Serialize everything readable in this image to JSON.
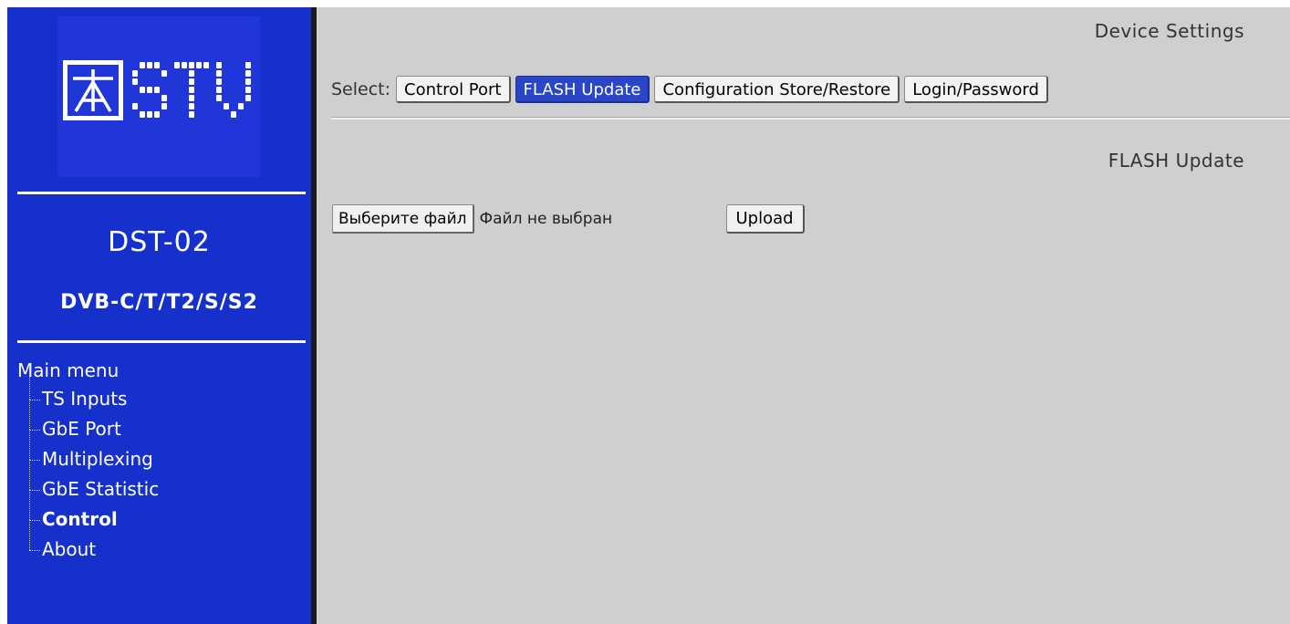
{
  "brand": {
    "logo_text": "STV",
    "icon": "stv-tower-logo-icon"
  },
  "device": {
    "model": "DST-02",
    "standards": "DVB-C/T/T2/S/S2"
  },
  "sidebar": {
    "menu_title": "Main menu",
    "items": [
      {
        "label": "TS Inputs",
        "active": false
      },
      {
        "label": "GbE Port",
        "active": false
      },
      {
        "label": "Multiplexing",
        "active": false
      },
      {
        "label": "GbE Statistic",
        "active": false
      },
      {
        "label": "Control",
        "active": true
      },
      {
        "label": "About",
        "active": false
      }
    ]
  },
  "header": {
    "title": "Device Settings"
  },
  "tabs": {
    "select_label": "Select:",
    "items": [
      {
        "label": "Control Port",
        "active": false
      },
      {
        "label": "FLASH Update",
        "active": true
      },
      {
        "label": "Configuration Store/Restore",
        "active": false
      },
      {
        "label": "Login/Password",
        "active": false
      }
    ]
  },
  "section": {
    "title": "FLASH Update",
    "file_button": "Выберите файл",
    "file_status": "Файл не выбран",
    "upload_button": "Upload"
  },
  "colors": {
    "sidebar_bg": "#1630cc",
    "main_bg": "#cfcfcf",
    "active_tab": "#2945c8"
  }
}
